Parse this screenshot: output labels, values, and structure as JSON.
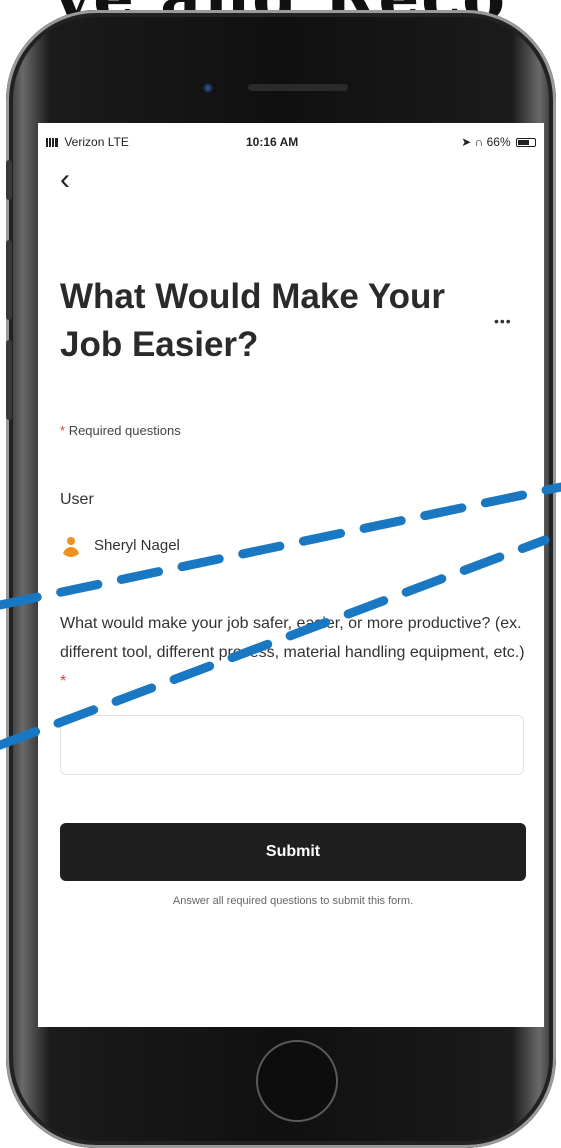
{
  "banner": {
    "text": "ve and Reco"
  },
  "status_bar": {
    "carrier": "Verizon",
    "network": "LTE",
    "time": "10:16 AM",
    "battery": "66%",
    "battery_level": 0.66
  },
  "header": {
    "back_icon": "chevron-left-icon",
    "more_label": "•••"
  },
  "form": {
    "title": "What Would Make Your Job Easier?",
    "required_star": "*",
    "required_note": "Required questions",
    "user_label": "User",
    "user_name": "Sheryl Nagel",
    "avatar_icon": "person-icon",
    "question_text": "What would make your job safer, easier, or more productive? (ex. different tool, different process, material handling equipment, etc.)",
    "question_required_star": "*",
    "answer_value": "",
    "answer_placeholder": "",
    "submit_label": "Submit",
    "submit_hint": "Answer all required questions to submit this form."
  },
  "colors": {
    "required_star": "#e0403a",
    "avatar": "#f0901f",
    "submit_bg": "#1f1f1f",
    "annotation_lines": "#1a78c2"
  }
}
